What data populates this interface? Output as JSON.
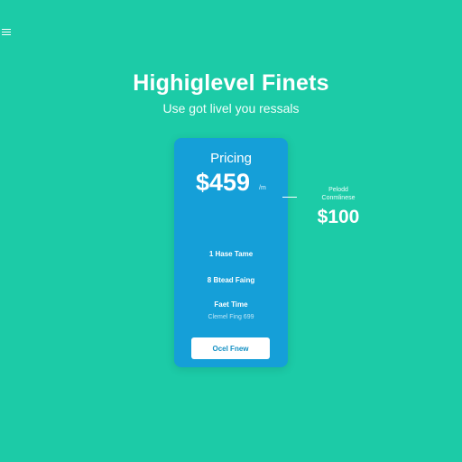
{
  "header": {
    "menu_icon": "hamburger-menu-icon"
  },
  "hero": {
    "title": "Highiglevel Finets",
    "subtitle": "Use got livel you ressals"
  },
  "card": {
    "title": "Pricing",
    "price": "$459",
    "price_suffix": "/m",
    "features": [
      "1 Hase Tame",
      "8 Btead Faing",
      "Faet Time"
    ],
    "note": "Clemel Fing 699",
    "button_label": "Ocel Fnew"
  },
  "side": {
    "caption_line1": "Pelodd",
    "caption_line2": "Conmlinese",
    "price": "$100"
  },
  "colors": {
    "background": "#1ccba7",
    "card": "#159fd8",
    "button_text": "#1490c4"
  }
}
